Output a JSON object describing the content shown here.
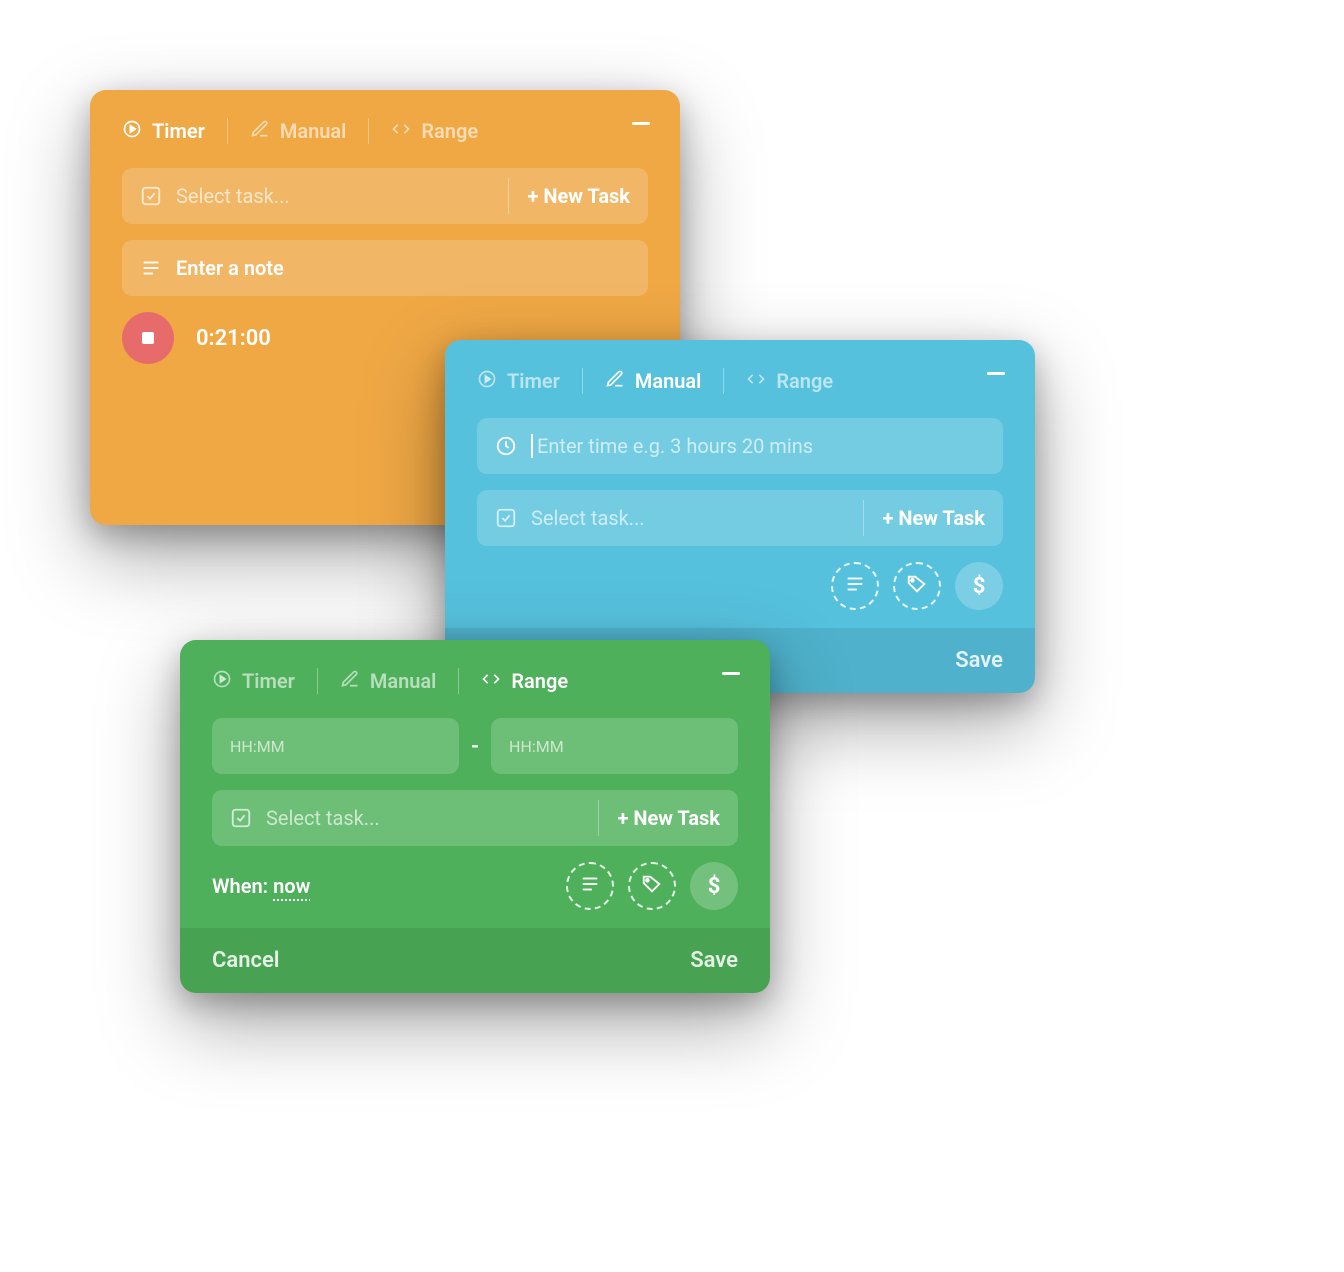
{
  "tabs": {
    "timer": "Timer",
    "manual": "Manual",
    "range": "Range"
  },
  "orange": {
    "select_task": "Select task...",
    "new_task": "+ New Task",
    "note_placeholder": "Enter a note",
    "timer_value": "0:21:00"
  },
  "blue": {
    "time_placeholder": "Enter time e.g. 3 hours 20 mins",
    "select_task": "Select task...",
    "new_task": "+ New Task",
    "save": "Save"
  },
  "green": {
    "hhmm": "HH:MM",
    "select_task": "Select task...",
    "new_task": "+ New Task",
    "when_label": "When: ",
    "when_value": "now",
    "cancel": "Cancel",
    "save": "Save"
  },
  "icons": {
    "dollar": "$"
  }
}
